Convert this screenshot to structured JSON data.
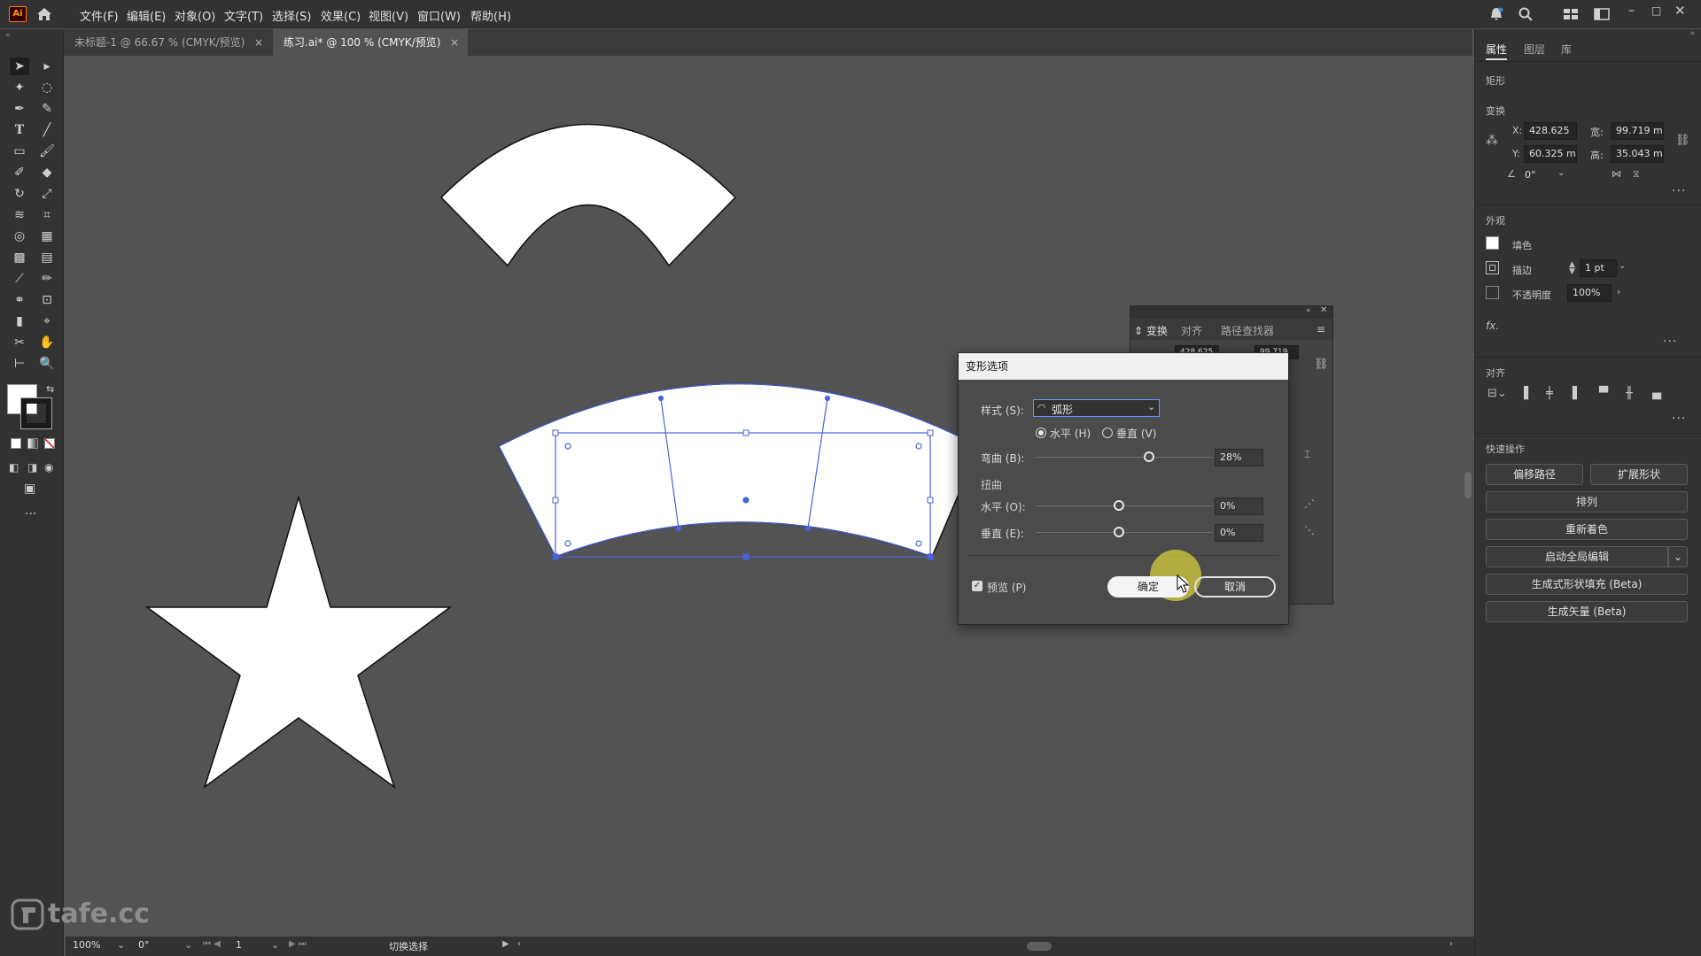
{
  "menubar": {
    "logo": "Ai",
    "items": [
      "文件(F)",
      "编辑(E)",
      "对象(O)",
      "文字(T)",
      "选择(S)",
      "效果(C)",
      "视图(V)",
      "窗口(W)",
      "帮助(H)"
    ]
  },
  "tabs": [
    {
      "label": "未标题-1 @ 66.67 % (CMYK/预览)",
      "close": "×"
    },
    {
      "label": "练习.ai* @ 100 % (CMYK/预览)",
      "close": "×"
    }
  ],
  "status": {
    "zoom": "100%",
    "rotate": "0°",
    "artboard": "1",
    "mode": "切换选择"
  },
  "watermark": "tafe.cc",
  "right_panel": {
    "tabs": [
      "属性",
      "图层",
      "库"
    ],
    "object_type": "矩形",
    "transform": {
      "heading": "变换",
      "x_label": "X:",
      "x": "428.625",
      "y_label": "Y:",
      "y": "60.325 m",
      "w_label": "宽:",
      "w": "99.719 m",
      "h_label": "高:",
      "h": "35.043 m",
      "angle": "0°"
    },
    "appearance": {
      "heading": "外观",
      "fill_label": "填色",
      "stroke_label": "描边",
      "stroke_value": "1 pt",
      "opacity_label": "不透明度",
      "opacity_value": "100%",
      "fx": "fx."
    },
    "align_heading": "对齐",
    "quick_actions": {
      "heading": "快速操作",
      "offset_path": "偏移路径",
      "expand_shape": "扩展形状",
      "arrange": "排列",
      "recolor": "重新着色",
      "global_edit": "启动全局编辑",
      "gen_shape_fill": "生成式形状填充 (Beta)",
      "gen_vector": "生成矢量 (Beta)"
    }
  },
  "float_panel": {
    "tabs": [
      "变换",
      "对齐",
      "路径查找器"
    ],
    "x_partial": "428.625",
    "w_partial": "99.719"
  },
  "dialog": {
    "title": "变形选项",
    "style_label": "样式 (S):",
    "style_value": "弧形",
    "horizontal_label": "水平 (H)",
    "vertical_label": "垂直 (V)",
    "orientation": "horizontal",
    "bend_label": "弯曲 (B):",
    "bend_value": "28%",
    "bend_fraction": 0.64,
    "distort_heading": "扭曲",
    "dist_h_label": "水平 (O):",
    "dist_h_value": "0%",
    "dist_v_label": "垂直 (E):",
    "dist_v_value": "0%",
    "preview_label": "预览 (P)",
    "preview_checked": true,
    "ok_label": "确定",
    "cancel_label": "取消"
  }
}
